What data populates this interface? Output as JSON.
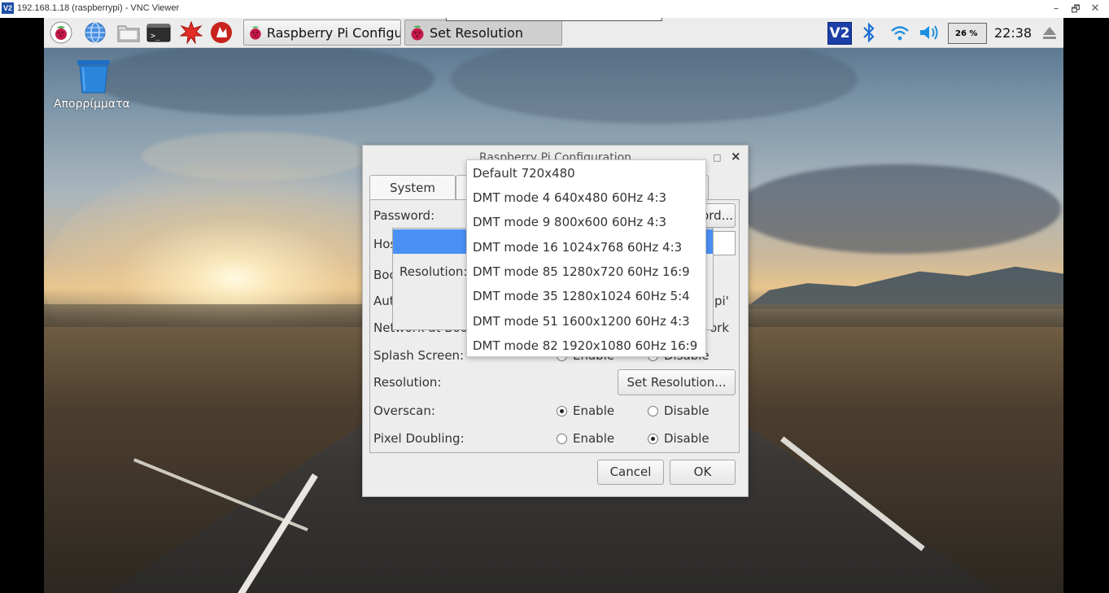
{
  "window": {
    "logo": "V2",
    "title": "192.168.1.18 (raspberrypi) - VNC Viewer",
    "controls": [
      "–",
      "🗗",
      "✕"
    ]
  },
  "taskbar": {
    "launchers": [
      "raspberry-menu-icon",
      "web-browser-icon",
      "file-manager-icon",
      "terminal-icon",
      "mathematica-icon",
      "wolfram-icon"
    ],
    "tasks": [
      {
        "label": "Raspberry Pi Configu...",
        "active": false
      },
      {
        "label": "Set Resolution",
        "active": true
      }
    ],
    "tray": {
      "vnc": "V2",
      "cpu": "26 %",
      "clock": "22:38"
    }
  },
  "desktop": {
    "trash_label": "Απορρίμματα"
  },
  "config_dialog": {
    "title": "Raspberry Pi Configuration",
    "max_glyph": "□",
    "close_glyph": "×",
    "tabs": [
      "System"
    ],
    "rows": {
      "password": "Password:",
      "hostname_visible": "Hos",
      "boot_visible": "Boo",
      "auto_login_visible": "Aut",
      "network_at_boot_visible": "Network at Boot:",
      "splash_screen": "Splash Screen:",
      "resolution": "Resolution:",
      "overscan": "Overscan:",
      "pixel_doubling": "Pixel Doubling:"
    },
    "change_password_visible": "ord...",
    "auto_login_suffix": "pi'",
    "network_suffix": "ork",
    "splash_enable_partial": "Enable",
    "splash_disable_partial": "Disable",
    "set_resolution_button": "Set Resolution...",
    "overscan": {
      "enable": "Enable",
      "disable": "Disable",
      "selected": "enable"
    },
    "pixel_doubling": {
      "enable": "Enable",
      "disable": "Disable",
      "selected": "disable"
    },
    "cancel": "Cancel",
    "ok": "OK"
  },
  "resolution_dialog": {
    "label": "Resolution:"
  },
  "resolution_menu": {
    "options": [
      "Default 720x480",
      "DMT mode 4 640x480 60Hz 4:3",
      "DMT mode 9 800x600 60Hz 4:3",
      "DMT mode 16 1024x768 60Hz 4:3",
      "DMT mode 85 1280x720 60Hz 16:9",
      "DMT mode 35 1280x1024 60Hz 5:4",
      "DMT mode 51 1600x1200 60Hz 4:3",
      "DMT mode 82 1920x1080 60Hz 16:9"
    ]
  },
  "colors": {
    "selection": "#4a90f5",
    "vnc_blue": "#1b3fa6"
  }
}
